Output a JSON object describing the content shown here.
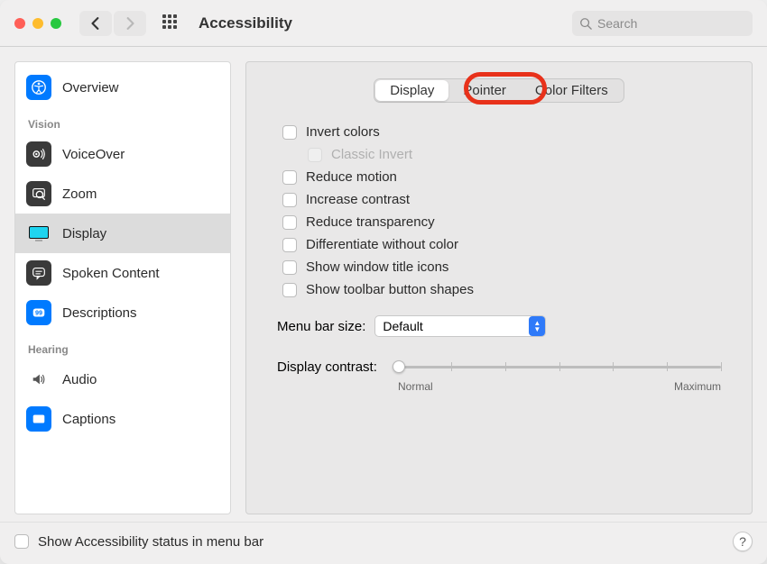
{
  "window": {
    "title": "Accessibility"
  },
  "search": {
    "placeholder": "Search"
  },
  "sidebar": {
    "sections": [
      {
        "header": null,
        "items": [
          {
            "label": "Overview"
          }
        ]
      },
      {
        "header": "Vision",
        "items": [
          {
            "label": "VoiceOver"
          },
          {
            "label": "Zoom"
          },
          {
            "label": "Display",
            "selected": true
          },
          {
            "label": "Spoken Content"
          },
          {
            "label": "Descriptions"
          }
        ]
      },
      {
        "header": "Hearing",
        "items": [
          {
            "label": "Audio"
          },
          {
            "label": "Captions"
          }
        ]
      }
    ]
  },
  "tabs": {
    "display": "Display",
    "pointer": "Pointer",
    "color_filters": "Color Filters",
    "active": "Display"
  },
  "checks": {
    "invert_colors": "Invert colors",
    "classic_invert": "Classic Invert",
    "reduce_motion": "Reduce motion",
    "increase_contrast": "Increase contrast",
    "reduce_transparency": "Reduce transparency",
    "differentiate": "Differentiate without color",
    "window_title_icons": "Show window title icons",
    "toolbar_shapes": "Show toolbar button shapes"
  },
  "menu_bar_size": {
    "label": "Menu bar size:",
    "value": "Default"
  },
  "contrast": {
    "label": "Display contrast:",
    "min_label": "Normal",
    "max_label": "Maximum",
    "value": 0
  },
  "footer": {
    "show_status": "Show Accessibility status in menu bar"
  }
}
